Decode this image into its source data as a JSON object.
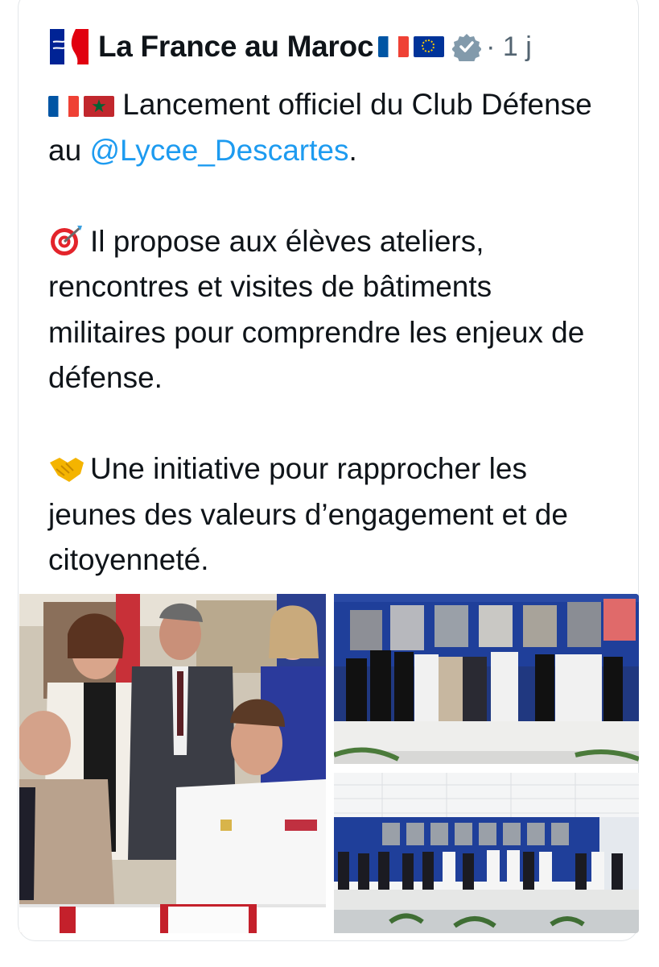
{
  "author": {
    "name": "La France au Maroc",
    "time": "· 1 j",
    "flags": [
      "france-flag",
      "eu-flag"
    ],
    "verified": "verified-badge-icon"
  },
  "tweet": {
    "flags": [
      "france-flag",
      "morocco-flag"
    ],
    "line1": "Lancement officiel du Club Défense au ",
    "mention": "@Lycee_Descartes",
    "line1_end": ".",
    "para2_emoji": "target-icon",
    "para2": "Il propose aux élèves ateliers, rencontres et visites de bâtiments militaires pour comprendre les enjeux de défense.",
    "para3_emoji": "handshake-icon",
    "para3": "Une initiative pour rapprocher les jeunes des valeurs d’engagement et de citoyenneté."
  },
  "media": [
    {
      "name": "photo-signing-ceremony"
    },
    {
      "name": "photo-handshake-room"
    },
    {
      "name": "photo-group-room"
    }
  ],
  "colors": {
    "mention": "#1d9bf0",
    "meta": "#536471",
    "wall_blue": "#1f3f9a"
  }
}
